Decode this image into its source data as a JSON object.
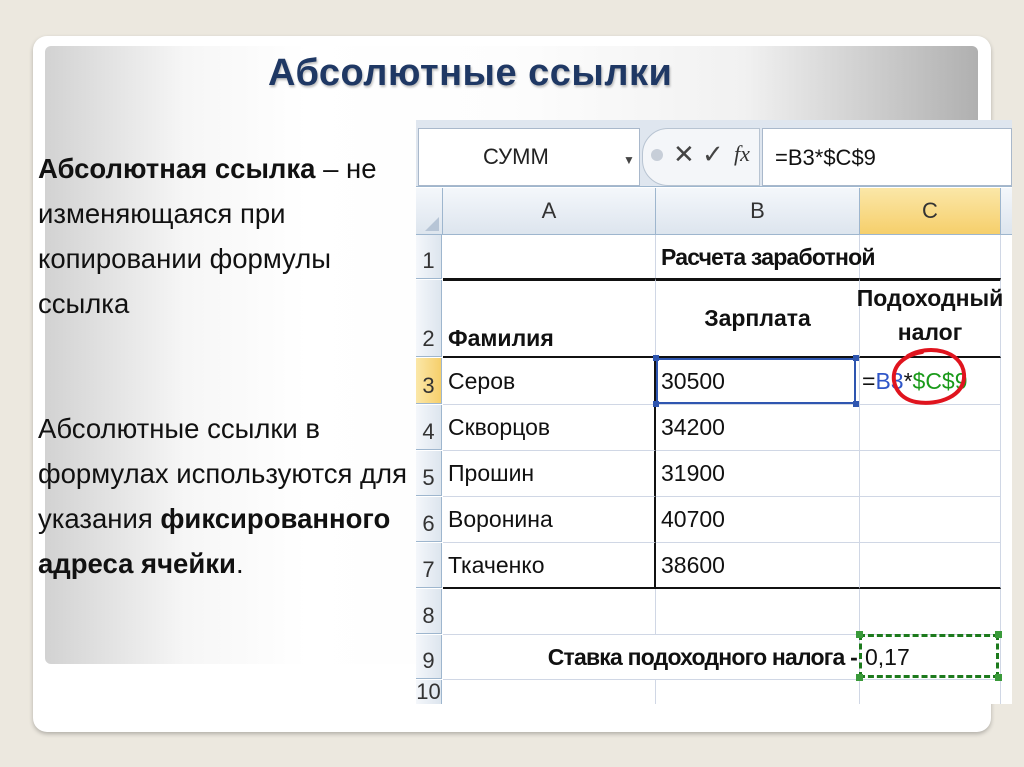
{
  "slide": {
    "title": "Абсолютные ссылки",
    "para1": {
      "term": "Абсолютная ссылка",
      "rest": " – не изменяющаяся при копировании формулы ссылка"
    },
    "para2": {
      "lead": "Абсолютные ссылки в формулах используются для указания ",
      "emphasis": "фиксированного адреса ячейки",
      "end": "."
    }
  },
  "sheet": {
    "name_box": "СУММ",
    "formula": "=B3*$C$9",
    "columns": [
      "A",
      "B",
      "C"
    ],
    "rows": [
      "1",
      "2",
      "3",
      "4",
      "5",
      "6",
      "7",
      "8",
      "9",
      "10"
    ],
    "title_cell": "Расчета заработной",
    "headers": {
      "surname": "Фамилия",
      "salary": "Зарплата",
      "tax": "Подоходный налог"
    },
    "data": [
      {
        "surname": "Серов",
        "salary": "30500"
      },
      {
        "surname": "Скворцов",
        "salary": "34200"
      },
      {
        "surname": "Прошин",
        "salary": "31900"
      },
      {
        "surname": "Воронина",
        "salary": "40700"
      },
      {
        "surname": "Ткаченко",
        "salary": "38600"
      }
    ],
    "editing_cell": {
      "prefix": "=",
      "ref_relative": "B3",
      "operator": "*",
      "ref_absolute": "$C$9"
    },
    "rate_label": "Ставка подоходного налога -",
    "rate_value": "0,17",
    "colors": {
      "relative_ref": "#2f56c8",
      "absolute_ref": "#1a9a1a",
      "annotation": "#e0141e"
    }
  }
}
